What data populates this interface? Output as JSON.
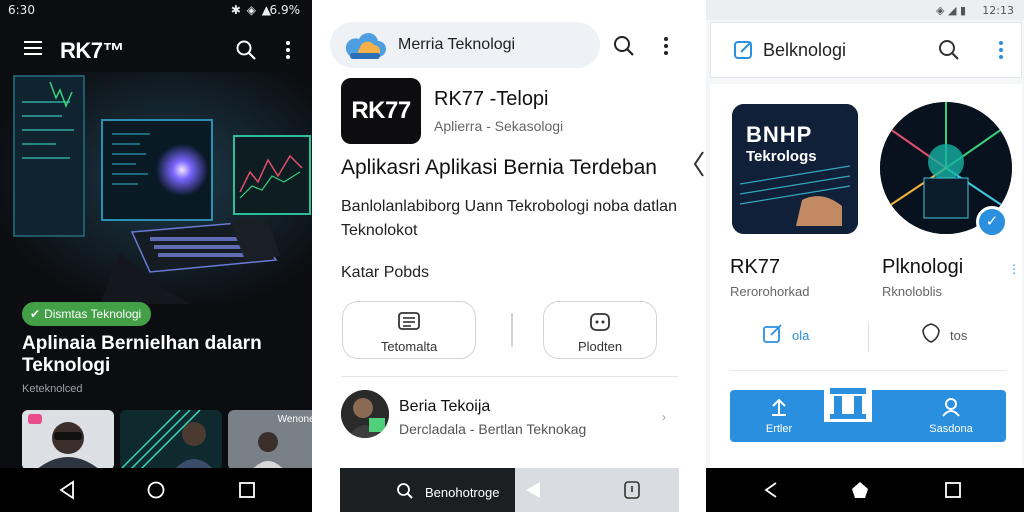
{
  "panel1": {
    "status": {
      "time": "6:30",
      "icons": "✱ ◈ ▲",
      "battery": "6.9%"
    },
    "logo": "RK7™",
    "category_pill": "Dismtas Teknologi",
    "headline": "Aplinaia Bernielhan dalarn Teknologi",
    "sub": "Keteknolced",
    "thumb_label": "Wenoner"
  },
  "panel2": {
    "search_placeholder": "Merria Teknologi",
    "app_icon_text": "RK77",
    "app_name": "RK77 -Telopi",
    "app_sub": "Aplierra - Sekasologi",
    "tagline": "Aplikasri Aplikasi Bernia Terdeban",
    "description": "Banlolanlabiborg Uann Tekrobologi noba datlan Teknolokot",
    "section_label": "Katar Pobds",
    "chip_left": "Tetomalta",
    "chip_right": "Plodten",
    "news_title": "Beria Tekoija",
    "news_sub": "Dercladala - Bertlan Teknokag",
    "news_more": "›",
    "bottom_text": "Benohotroge"
  },
  "panel3": {
    "status": {
      "icons": "◈ ◢ ▮",
      "time": "12:13"
    },
    "title": "Belknologi",
    "card_text_1": "BNHP",
    "card_text_2": "Tekrologs",
    "name_left": "RK77",
    "sub_left": "Rerorohorkad",
    "name_right": "Plknologi",
    "sub_right": "Rknoloblis",
    "action_left": "ola",
    "action_right": "tos",
    "tab_left": "Ertler",
    "tab_right": "Sasdona",
    "badge": "✓",
    "dots": "⋮"
  },
  "colors": {
    "accent_green": "#43a047",
    "accent_blue": "#2b8fe0",
    "dark_bg": "#0b0d10"
  }
}
